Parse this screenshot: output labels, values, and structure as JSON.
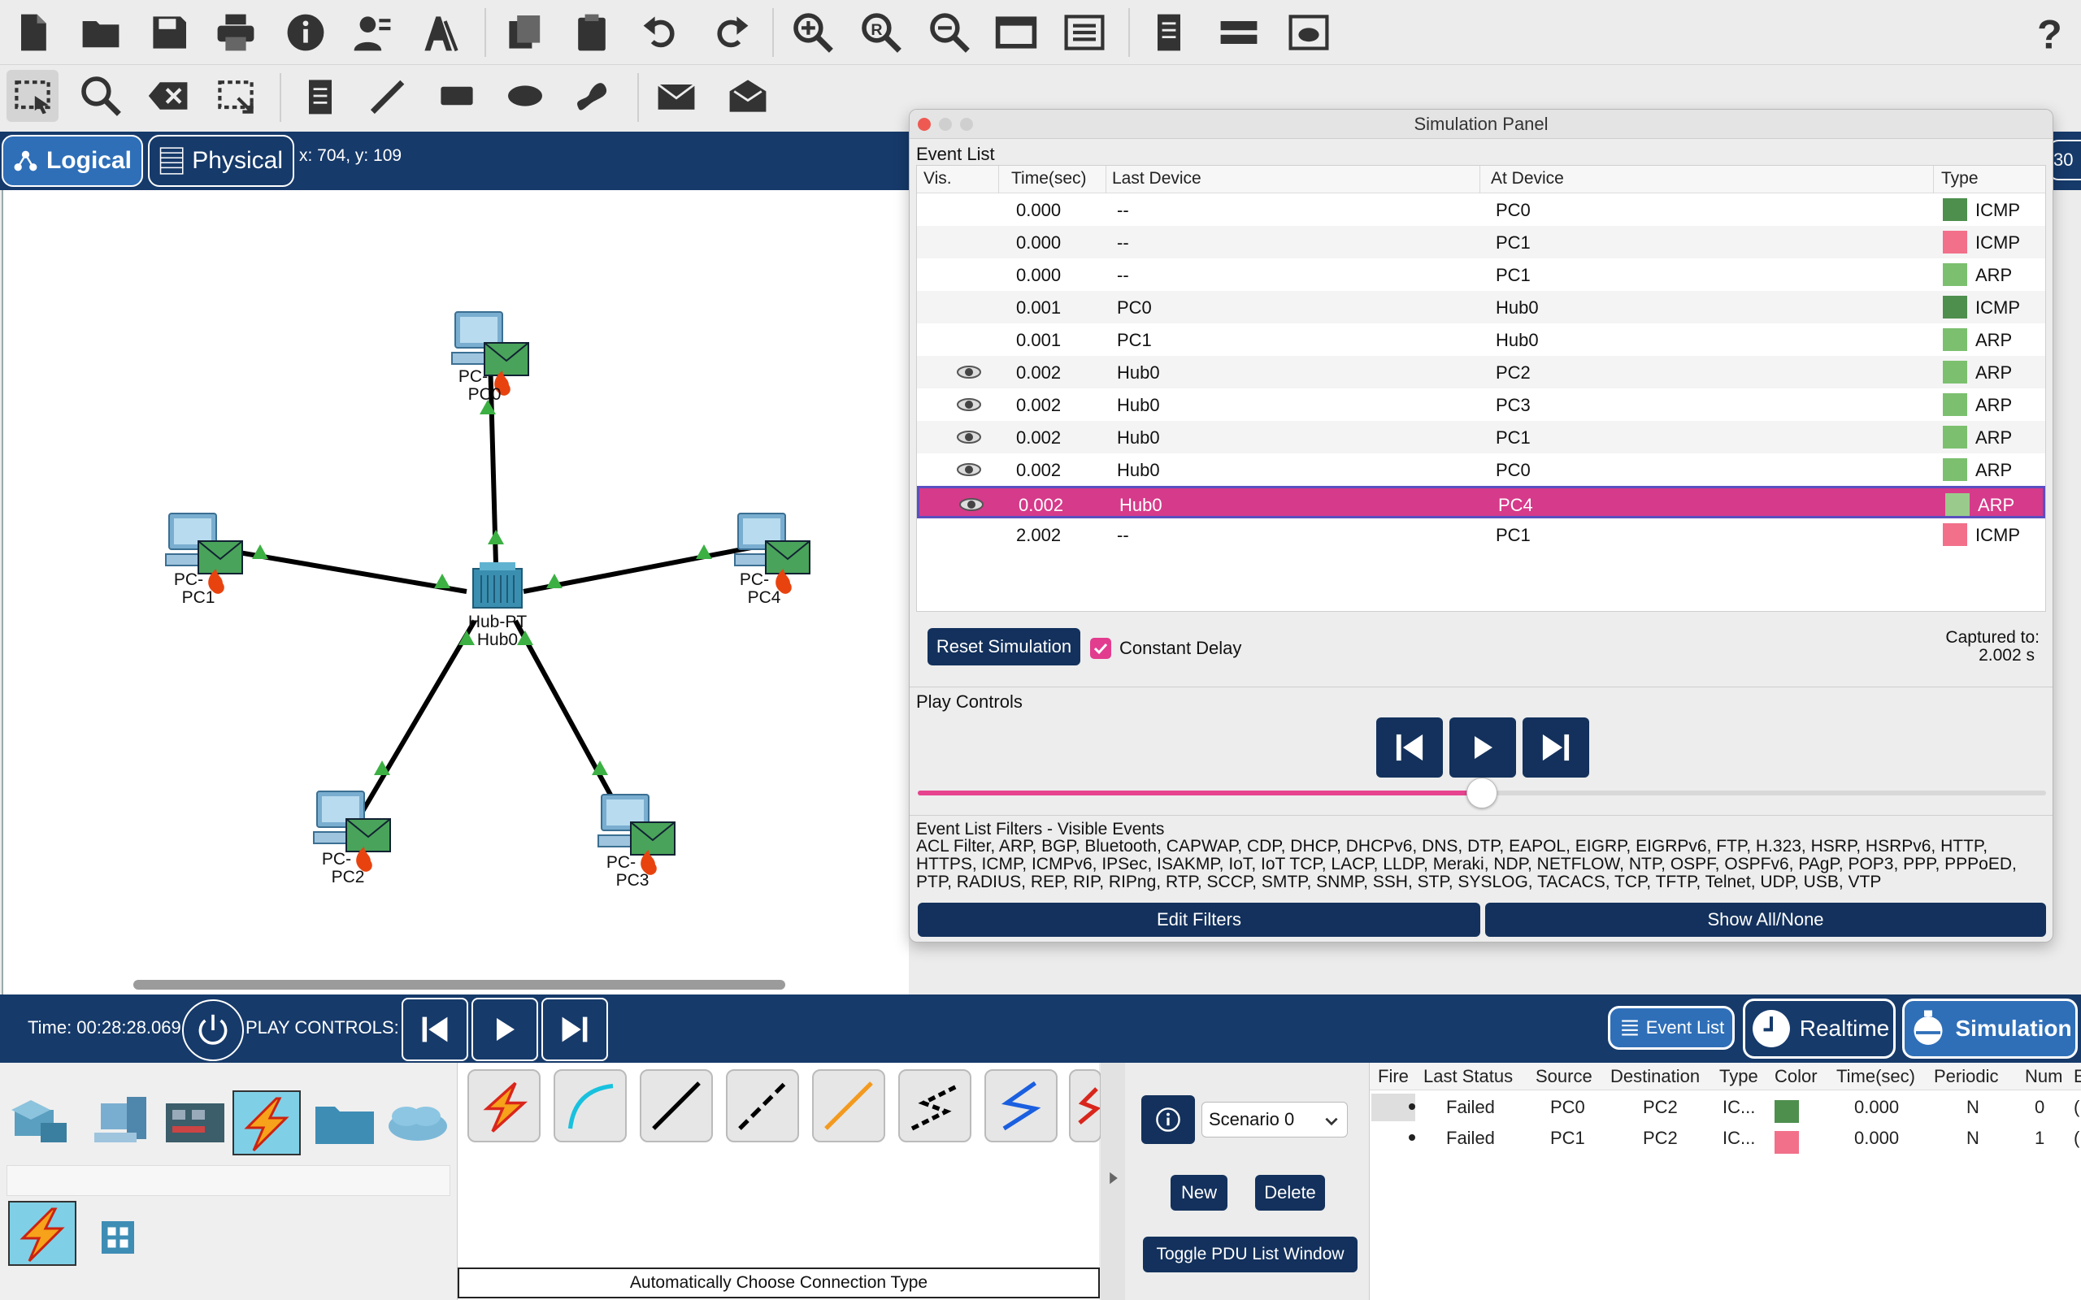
{
  "toolbar": {
    "icons_row1": [
      "new-file-icon",
      "open-folder-icon",
      "save-icon",
      "print-icon",
      "info-icon",
      "user-profile-icon",
      "activity-wizard-icon",
      "copy-icon",
      "paste-icon",
      "undo-icon",
      "redo-icon",
      "zoom-in-icon",
      "zoom-reset-icon",
      "zoom-out-icon",
      "window-icon",
      "palette-icon",
      "notes-icon",
      "device-icon",
      "cloud-window-icon",
      "help-icon"
    ],
    "icons_row2": [
      "select-icon",
      "inspect-icon",
      "delete-icon",
      "resize-icon",
      "note-icon",
      "draw-line-icon",
      "rectangle-icon",
      "ellipse-icon",
      "freeform-icon",
      "simple-pdu-icon",
      "complex-pdu-icon"
    ]
  },
  "viewbar": {
    "logical_label": "Logical",
    "physical_label": "Physical",
    "coords": "x: 704, y: 109",
    "partial_right": "30"
  },
  "topology": {
    "devices": [
      {
        "name": "PC0",
        "label_top": "PC-",
        "label_bottom": "PC0"
      },
      {
        "name": "PC1",
        "label_top": "PC-",
        "label_bottom": "PC1"
      },
      {
        "name": "PC2",
        "label_top": "PC-",
        "label_bottom": "PC2"
      },
      {
        "name": "PC3",
        "label_top": "PC-",
        "label_bottom": "PC3"
      },
      {
        "name": "PC4",
        "label_top": "PC-",
        "label_bottom": "PC4"
      },
      {
        "name": "Hub0",
        "label_top": "Hub-PT",
        "label_bottom": "Hub0"
      }
    ]
  },
  "sim_panel": {
    "title": "Simulation Panel",
    "event_list_label": "Event List",
    "columns": [
      "Vis.",
      "Time(sec)",
      "Last Device",
      "At Device",
      "Type"
    ],
    "events": [
      {
        "vis": false,
        "time": "0.000",
        "last": "--",
        "at": "PC0",
        "type": "ICMP",
        "color": "#4e8f4e",
        "selected": false
      },
      {
        "vis": false,
        "time": "0.000",
        "last": "--",
        "at": "PC1",
        "type": "ICMP",
        "color": "#f2708a",
        "selected": false
      },
      {
        "vis": false,
        "time": "0.000",
        "last": "--",
        "at": "PC1",
        "type": "ARP",
        "color": "#7cc06f",
        "selected": false
      },
      {
        "vis": false,
        "time": "0.001",
        "last": "PC0",
        "at": "Hub0",
        "type": "ICMP",
        "color": "#4e8f4e",
        "selected": false
      },
      {
        "vis": false,
        "time": "0.001",
        "last": "PC1",
        "at": "Hub0",
        "type": "ARP",
        "color": "#7cc06f",
        "selected": false
      },
      {
        "vis": true,
        "time": "0.002",
        "last": "Hub0",
        "at": "PC2",
        "type": "ARP",
        "color": "#7cc06f",
        "selected": false
      },
      {
        "vis": true,
        "time": "0.002",
        "last": "Hub0",
        "at": "PC3",
        "type": "ARP",
        "color": "#7cc06f",
        "selected": false
      },
      {
        "vis": true,
        "time": "0.002",
        "last": "Hub0",
        "at": "PC1",
        "type": "ARP",
        "color": "#7cc06f",
        "selected": false
      },
      {
        "vis": true,
        "time": "0.002",
        "last": "Hub0",
        "at": "PC0",
        "type": "ARP",
        "color": "#7cc06f",
        "selected": false
      },
      {
        "vis": true,
        "time": "0.002",
        "last": "Hub0",
        "at": "PC4",
        "type": "ARP",
        "color": "#9acb8c",
        "selected": true
      },
      {
        "vis": false,
        "time": "2.002",
        "last": "--",
        "at": "PC1",
        "type": "ICMP",
        "color": "#f2708a",
        "selected": false
      }
    ],
    "reset_label": "Reset Simulation",
    "constant_delay_label": "Constant Delay",
    "constant_delay_checked": true,
    "captured_label": "Captured to:",
    "captured_value": "2.002 s",
    "play_controls_label": "Play Controls",
    "slider_position": 0.5,
    "filters_label": "Event List Filters - Visible Events",
    "filters_text": "ACL Filter, ARP, BGP, Bluetooth, CAPWAP, CDP, DHCP, DHCPv6, DNS, DTP, EAPOL, EIGRP, EIGRPv6, FTP, H.323, HSRP, HSRPv6, HTTP, HTTPS, ICMP, ICMPv6, IPSec, ISAKMP, IoT, IoT TCP, LACP, LLDP, Meraki, NDP, NETFLOW, NTP, OSPF, OSPFv6, PAgP, POP3, PPP, PPPoED, PTP, RADIUS, REP, RIP, RIPng, RTP, SCCP, SMTP, SNMP, SSH, STP, SYSLOG, TACACS, TCP, TFTP, Telnet, UDP, USB, VTP",
    "edit_filters_label": "Edit Filters",
    "show_all_label": "Show All/None"
  },
  "bottom_bar": {
    "time_text": "Time: 00:28:28.069",
    "play_controls_text": "PLAY CONTROLS:",
    "event_list_btn": "Event List",
    "realtime_btn": "Realtime",
    "simulation_btn": "Simulation"
  },
  "device_panel": {
    "categories": [
      "network-devices-icon",
      "end-devices-icon",
      "components-icon",
      "connections-icon",
      "misc-icon",
      "multiuser-icon"
    ],
    "connection_types": [
      "auto-connection-icon",
      "console-cable-icon",
      "copper-straight-icon",
      "copper-cross-icon",
      "fiber-icon",
      "phone-cable-icon",
      "coaxial-icon",
      "serial-dce-icon"
    ],
    "connection_caption": "Automatically Choose Connection Type"
  },
  "scenario": {
    "label": "Scenario 0",
    "new_label": "New",
    "delete_label": "Delete",
    "toggle_label": "Toggle PDU List Window"
  },
  "pdu_list": {
    "columns": [
      "Fire",
      "Last Status",
      "Source",
      "Destination",
      "Type",
      "Color",
      "Time(sec)",
      "Periodic",
      "Num",
      "E"
    ],
    "rows": [
      {
        "fire": "",
        "status": "Failed",
        "source": "PC0",
        "dest": "PC2",
        "type": "IC...",
        "color": "#4e8f4e",
        "time": "0.000",
        "periodic": "N",
        "num": "0",
        "edit": "("
      },
      {
        "fire": "",
        "status": "Failed",
        "source": "PC1",
        "dest": "PC2",
        "type": "IC...",
        "color": "#f2708a",
        "time": "0.000",
        "periodic": "N",
        "num": "1",
        "edit": "("
      }
    ]
  }
}
